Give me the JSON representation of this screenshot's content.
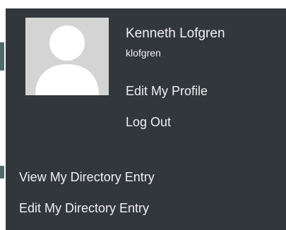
{
  "account_menu": {
    "avatar_icon": "default-avatar-icon",
    "display_name": "Kenneth Lofgren",
    "username": "klofgren",
    "edit_profile_label": "Edit My Profile",
    "logout_label": "Log Out"
  },
  "directory_links": {
    "view_entry_label": "View My Directory Entry",
    "edit_entry_label": "Edit My Directory Entry"
  },
  "colors": {
    "panel_background": "#32373c",
    "text": "#f0f0f1",
    "avatar_background": "#d4d4d4",
    "avatar_silhouette": "#ffffff"
  }
}
